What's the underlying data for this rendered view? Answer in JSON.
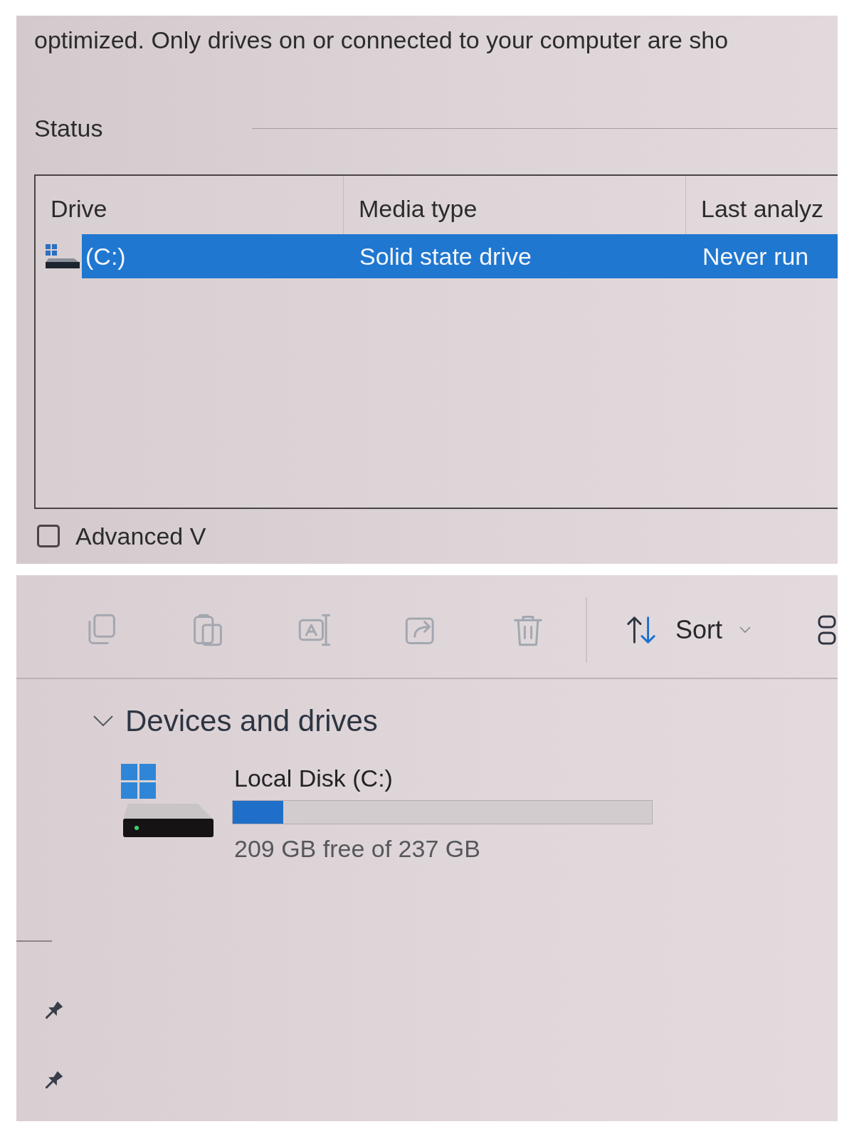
{
  "defrag_dialog": {
    "description": "optimized. Only drives on or connected to your computer are sho",
    "status_label": "Status",
    "drive_table": {
      "columns": [
        "Drive",
        "Media type",
        "Last analyz"
      ],
      "rows": [
        {
          "cells": [
            "(C:)",
            "Solid state drive",
            "Never run"
          ],
          "selected": true
        }
      ]
    },
    "advanced_view": {
      "label": "Advanced V",
      "checked": false
    }
  },
  "file_explorer": {
    "toolbar": {
      "actions": [
        {
          "kind": "copy",
          "disabled": true
        },
        {
          "kind": "paste",
          "disabled": true
        },
        {
          "kind": "rename",
          "disabled": true
        },
        {
          "kind": "share",
          "disabled": true
        },
        {
          "kind": "delete",
          "disabled": true
        }
      ],
      "sort_button": {
        "label": "Sort"
      }
    },
    "nav_pane": {
      "items": [
        {
          "pinned": true
        },
        {
          "pinned": true
        }
      ]
    },
    "section": {
      "title": "Devices and drives",
      "expanded": true,
      "drives": [
        {
          "name": "Local Disk (C:)",
          "level": 0.12,
          "space": "209 GB free of 237 GB"
        }
      ]
    }
  }
}
